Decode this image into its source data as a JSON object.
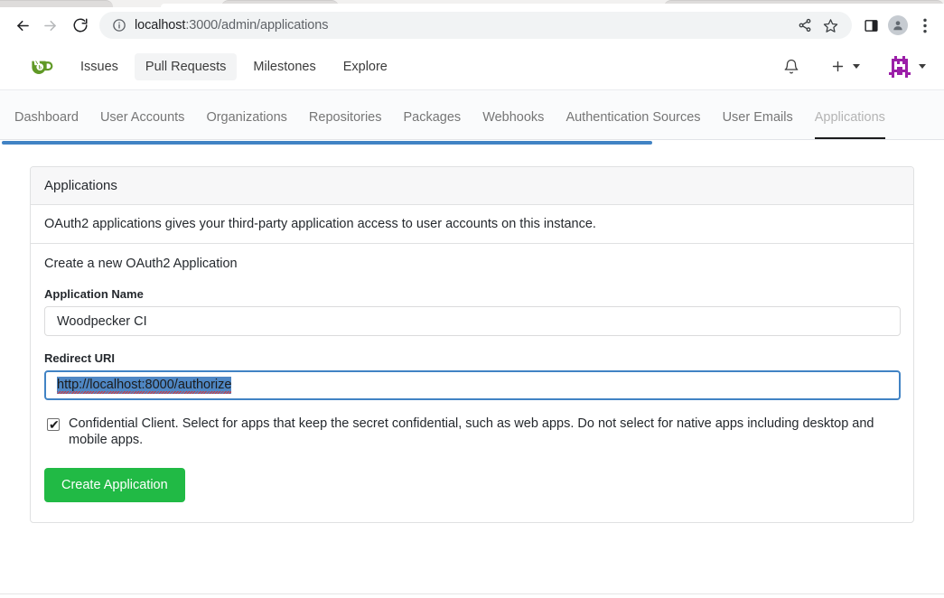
{
  "browser": {
    "nav": {
      "back": "Back",
      "forward": "Forward",
      "reload": "Reload"
    },
    "omnibox": {
      "host": "localhost",
      "path": ":3000/admin/applications",
      "full_url": "localhost:3000/admin/applications",
      "site_info_icon": "info-circle-icon",
      "share_icon": "share-icon",
      "bookmark_icon": "star-icon"
    },
    "right": {
      "side_panel_icon": "side-panel-icon",
      "profile_icon": "profile-avatar-icon",
      "menu_icon": "three-dot-menu-icon"
    }
  },
  "gitea_nav": {
    "logo_label": "Gitea",
    "links": [
      {
        "label": "Issues",
        "active": false
      },
      {
        "label": "Pull Requests",
        "active": true
      },
      {
        "label": "Milestones",
        "active": false
      },
      {
        "label": "Explore",
        "active": false
      }
    ],
    "notifications_icon": "bell-icon",
    "create_icon": "plus-icon",
    "create_caret_icon": "chevron-down-icon",
    "avatar_icon": "user-avatar-identicon",
    "avatar_caret_icon": "chevron-down-icon"
  },
  "admin_tabs": [
    {
      "label": "Dashboard",
      "active": false
    },
    {
      "label": "User Accounts",
      "active": false
    },
    {
      "label": "Organizations",
      "active": false
    },
    {
      "label": "Repositories",
      "active": false
    },
    {
      "label": "Packages",
      "active": false
    },
    {
      "label": "Webhooks",
      "active": false
    },
    {
      "label": "Authentication Sources",
      "active": false
    },
    {
      "label": "User Emails",
      "active": false
    },
    {
      "label": "Applications",
      "active": true
    }
  ],
  "loading_bar": {
    "progress_percent": 69,
    "color": "#4183c4"
  },
  "card": {
    "header": "Applications",
    "description": "OAuth2 applications gives your third-party application access to user accounts on this instance.",
    "form_title": "Create a new OAuth2 Application",
    "fields": {
      "app_name": {
        "label": "Application Name",
        "value": "Woodpecker CI",
        "placeholder": ""
      },
      "redirect_uri": {
        "label": "Redirect URI",
        "value": "http://localhost:8000/authorize",
        "placeholder": "",
        "focused": true,
        "text_selected": true
      }
    },
    "checkbox": {
      "label": "Confidential Client. Select for apps that keep the secret confidential, such as web apps. Do not select for native apps including desktop and mobile apps.",
      "checked": true,
      "tick": "✔"
    },
    "submit_button": "Create Application"
  },
  "colors": {
    "accent_green": "#21ba45",
    "accent_blue": "#4183c4",
    "selection_blue": "#4f87c4",
    "tab_active_underline": "#1b1c1d"
  }
}
